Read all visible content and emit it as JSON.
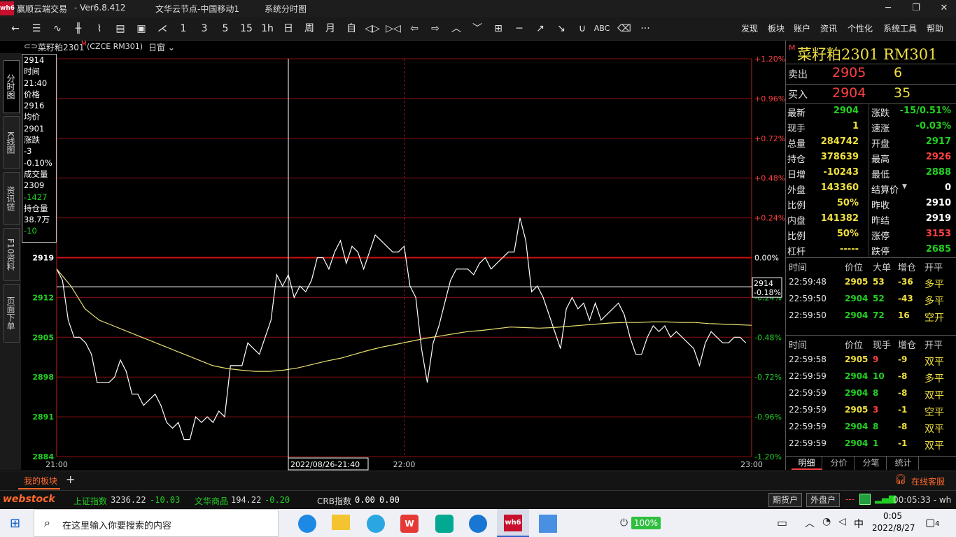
{
  "window": {
    "title": "赢顺云端交易",
    "version": "-  Ver6.8.412",
    "server": "文华云节点-中国移动1",
    "view_name": "系统分时图",
    "logo_text": "wh6"
  },
  "toolbar": {
    "periods": [
      "1",
      "3",
      "5",
      "15",
      "1h",
      "日",
      "周",
      "月",
      "自"
    ],
    "abc_label": "ABC",
    "more_label": "···",
    "menu": [
      "发现",
      "板块",
      "账户",
      "资讯",
      "个性化",
      "系统工具",
      "帮助"
    ]
  },
  "left_tabs": [
    "分时图",
    "K线图",
    "资讯链",
    "F10资料",
    "页面下单"
  ],
  "chart_header": {
    "instrument": "菜籽粕2301",
    "main_mark": "M",
    "code": "(CZCE RM301)",
    "mode": "日窗"
  },
  "infobox": [
    {
      "text": "2914",
      "color": "#ffffff"
    },
    {
      "text": "时间",
      "color": "#ffffff"
    },
    {
      "text": "21:40",
      "color": "#ffffff"
    },
    {
      "text": "价格",
      "color": "#ffffff"
    },
    {
      "text": "2916",
      "color": "#ffffff"
    },
    {
      "text": "均价",
      "color": "#ffffff"
    },
    {
      "text": "2901",
      "color": "#ffffff"
    },
    {
      "text": "涨跌",
      "color": "#ffffff"
    },
    {
      "text": "-3",
      "color": "#ffffff"
    },
    {
      "text": "-0.10%",
      "color": "#ffffff"
    },
    {
      "text": "成交量",
      "color": "#ffffff"
    },
    {
      "text": "2309",
      "color": "#ffffff"
    },
    {
      "text": "-1427",
      "color": "#22d022"
    },
    {
      "text": "持仓量",
      "color": "#ffffff"
    },
    {
      "text": "38.7万",
      "color": "#ffffff"
    },
    {
      "text": "-10",
      "color": "#22d022"
    }
  ],
  "chart_data": {
    "type": "line",
    "title": "",
    "y_left_ticks": [
      "2919",
      "2912",
      "2905",
      "2898",
      "2891",
      "2884"
    ],
    "y_right_ticks": [
      "+1.20%",
      "+0.96%",
      "+0.72%",
      "+0.48%",
      "+0.24%",
      "0.00%",
      "-0.24%",
      "-0.48%",
      "-0.72%",
      "-0.96%",
      "-1.20%"
    ],
    "x_ticks": [
      "21:00",
      "22:00",
      "23:00"
    ],
    "ylim": [
      2884,
      2954
    ],
    "prev_settle": 2919,
    "crosshair_label": "2022/08/26-21:40",
    "crosshair_price": "2914",
    "crosshair_pct": "-0.18%",
    "series": [
      {
        "name": "价格",
        "color": "#ffffff",
        "values": [
          2917,
          2915,
          2908,
          2905,
          2905,
          2904,
          2902,
          2897,
          2897,
          2897,
          2898,
          2901,
          2899,
          2895,
          2895,
          2893,
          2894,
          2895,
          2893,
          2890,
          2889,
          2890,
          2887,
          2887,
          2891,
          2890,
          2891,
          2890,
          2892,
          2891,
          2900,
          2900,
          2900,
          2904,
          2903,
          2902,
          2905,
          2908,
          2916,
          2914,
          2916,
          2912,
          2914,
          2913,
          2915,
          2919,
          2919,
          2917,
          2920,
          2922,
          2918,
          2921,
          2920,
          2917,
          2920,
          2923,
          2922,
          2921,
          2920,
          2920,
          2921,
          2914,
          2912,
          2903,
          2897,
          2904,
          2907,
          2911,
          2915,
          2917,
          2917,
          2917,
          2916,
          2918,
          2919,
          2917,
          2918,
          2919,
          2920,
          2920,
          2926,
          2922,
          2913,
          2914,
          2912,
          2909,
          2906,
          2903,
          2910,
          2912,
          2910,
          2911,
          2908,
          2911,
          2908,
          2909,
          2910,
          2911,
          2909,
          2905,
          2902,
          2902,
          2905,
          2907,
          2906,
          2907,
          2905,
          2906,
          2905,
          2904,
          2903,
          2900,
          2904,
          2906,
          2905,
          2904,
          2904,
          2905,
          2905,
          2904
        ]
      },
      {
        "name": "均价",
        "color": "#e8e070",
        "values": [
          2917,
          2914,
          2910,
          2908,
          2907,
          2906,
          2905,
          2904,
          2903,
          2902,
          2901,
          2900,
          2899.5,
          2899.2,
          2899,
          2899,
          2899.2,
          2899.6,
          2900.2,
          2900.8,
          2901.3,
          2902,
          2902.7,
          2903.3,
          2903.8,
          2904.3,
          2904.8,
          2905.2,
          2905.6,
          2906,
          2906.2,
          2906.5,
          2906.8,
          2906.7,
          2906.6,
          2906.7,
          2906.9,
          2907.1,
          2907.3,
          2907.5,
          2907.6,
          2907.6,
          2907.7,
          2907.7,
          2907.6,
          2907.6,
          2907.4,
          2907.3,
          2907.2,
          2907.1
        ]
      }
    ]
  },
  "quote": {
    "main_mark": "M",
    "title": "菜籽粕2301 RM301",
    "sell": {
      "label": "卖出",
      "price": "2905",
      "vol": "6"
    },
    "buy": {
      "label": "买入",
      "price": "2904",
      "vol": "35"
    },
    "rows": [
      {
        "l1": "最新",
        "v1": "2904",
        "c1": "#22d022",
        "l2": "涨跌",
        "v2": "-15/0.51%",
        "c2": "#22d022"
      },
      {
        "l1": "现手",
        "v1": "1",
        "c1": "#f0e040",
        "l2": "速涨",
        "v2": "-0.03%",
        "c2": "#22d022"
      },
      {
        "l1": "总量",
        "v1": "284742",
        "c1": "#f0e040",
        "l2": "开盘",
        "v2": "2917",
        "c2": "#22d022"
      },
      {
        "l1": "持仓",
        "v1": "378639",
        "c1": "#f0e040",
        "l2": "最高",
        "v2": "2926",
        "c2": "#ff4040"
      },
      {
        "l1": "日增",
        "v1": "-10243",
        "c1": "#f0e040",
        "l2": "最低",
        "v2": "2888",
        "c2": "#22d022"
      },
      {
        "l1": "外盘",
        "v1": "143360",
        "c1": "#f0e040",
        "l2": "结算价",
        "v2": "0",
        "c2": "#ffffff"
      },
      {
        "l1": "比例",
        "v1": "50%",
        "c1": "#f0e040",
        "l2": "昨收",
        "v2": "2910",
        "c2": "#ffffff"
      },
      {
        "l1": "内盘",
        "v1": "141382",
        "c1": "#f0e040",
        "l2": "昨结",
        "v2": "2919",
        "c2": "#ffffff"
      },
      {
        "l1": "比例",
        "v1": "50%",
        "c1": "#f0e040",
        "l2": "涨停",
        "v2": "3153",
        "c2": "#ff4040"
      },
      {
        "l1": "杠杆",
        "v1": "-----",
        "c1": "#f0e040",
        "l2": "跌停",
        "v2": "2685",
        "c2": "#22d022"
      }
    ],
    "big_header": [
      "时间",
      "价位",
      "大单",
      "增仓",
      "开平"
    ],
    "big_trades": [
      {
        "time": "22:59:48",
        "price": "2905",
        "vol": "53",
        "inc": "-36",
        "type": "多平",
        "pc": "#f0e040",
        "vc": "#f0e040",
        "ic": "#f0e040",
        "tc": "#f0e040"
      },
      {
        "time": "22:59:50",
        "price": "2904",
        "vol": "52",
        "inc": "-43",
        "type": "多平",
        "pc": "#22d022",
        "vc": "#22d022",
        "ic": "#f0e040",
        "tc": "#f0e040"
      },
      {
        "time": "22:59:50",
        "price": "2904",
        "vol": "72",
        "inc": "16",
        "type": "空开",
        "pc": "#22d022",
        "vc": "#22d022",
        "ic": "#f0e040",
        "tc": "#f0e040"
      }
    ],
    "tick_header": [
      "时间",
      "价位",
      "现手",
      "增仓",
      "开平"
    ],
    "ticks": [
      {
        "time": "22:59:58",
        "price": "2905",
        "vol": "9",
        "inc": "-9",
        "type": "双平",
        "pc": "#f0e040",
        "vc": "#ff4040",
        "ic": "#f0e040",
        "tc": "#f0e040"
      },
      {
        "time": "22:59:59",
        "price": "2904",
        "vol": "10",
        "inc": "-8",
        "type": "多平",
        "pc": "#22d022",
        "vc": "#22d022",
        "ic": "#f0e040",
        "tc": "#f0e040"
      },
      {
        "time": "22:59:59",
        "price": "2904",
        "vol": "8",
        "inc": "-8",
        "type": "双平",
        "pc": "#22d022",
        "vc": "#22d022",
        "ic": "#f0e040",
        "tc": "#f0e040"
      },
      {
        "time": "22:59:59",
        "price": "2905",
        "vol": "3",
        "inc": "-1",
        "type": "空平",
        "pc": "#f0e040",
        "vc": "#ff4040",
        "ic": "#f0e040",
        "tc": "#f0e040"
      },
      {
        "time": "22:59:59",
        "price": "2904",
        "vol": "8",
        "inc": "-8",
        "type": "双平",
        "pc": "#22d022",
        "vc": "#22d022",
        "ic": "#f0e040",
        "tc": "#f0e040"
      },
      {
        "time": "22:59:59",
        "price": "2904",
        "vol": "1",
        "inc": "-1",
        "type": "双平",
        "pc": "#22d022",
        "vc": "#22d022",
        "ic": "#f0e040",
        "tc": "#f0e040"
      }
    ],
    "bottom_tabs": [
      "明细",
      "分价",
      "分笔",
      "统计"
    ]
  },
  "tabbar": {
    "my_block": "我的板块",
    "add": "+",
    "online_service": "在线客服"
  },
  "statusbar": {
    "brand": "webstock",
    "indexes": [
      {
        "name": "上证指数",
        "value": "3236.22",
        "change": "-10.03"
      },
      {
        "name": "文华商品",
        "value": "194.22",
        "change": "-0.20"
      }
    ],
    "crb_name": "CRB指数",
    "crb_value": "0.00",
    "crb_change": "0.00",
    "futures_btn": "期货户",
    "external_btn": "外盘户",
    "dashes": "---",
    "clock": "00:05:33 - wh"
  },
  "taskbar": {
    "search_placeholder": "在这里输入你要搜索的内容",
    "battery": "100%",
    "ime": "中",
    "time": "0:05",
    "date": "2022/8/27",
    "notifications": "4"
  }
}
